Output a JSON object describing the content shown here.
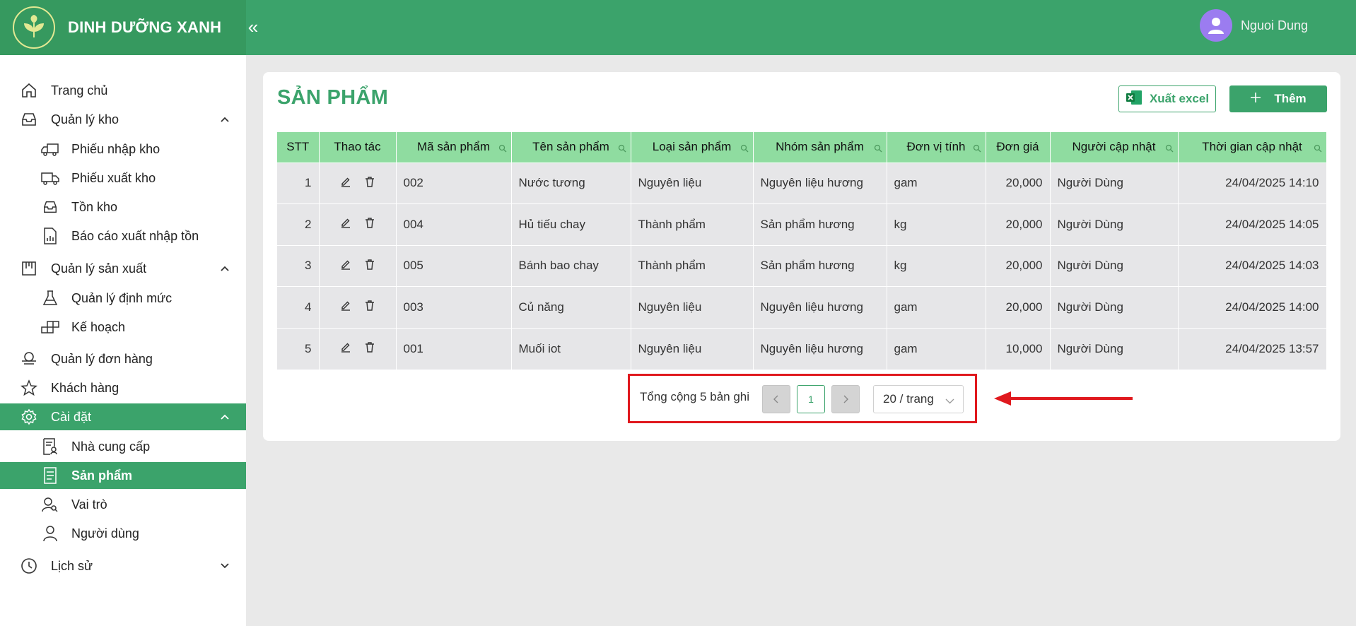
{
  "header": {
    "brand": "DINH DƯỠNG XANH",
    "collapse": "«",
    "user_name": "Nguoi Dung"
  },
  "sidebar": {
    "home": "Trang chủ",
    "warehouse": "Quản lý kho",
    "import_slip": "Phiếu nhập kho",
    "export_slip": "Phiếu xuất kho",
    "stock": "Tồn kho",
    "report": "Báo cáo xuất nhập tồn",
    "production": "Quản lý sản xuất",
    "norm": "Quản lý định mức",
    "plan": "Kế hoạch",
    "orders": "Quản lý đơn hàng",
    "customers": "Khách hàng",
    "settings": "Cài đặt",
    "suppliers": "Nhà cung cấp",
    "products": "Sản phẩm",
    "roles": "Vai trò",
    "users": "Người dùng",
    "history": "Lịch sử"
  },
  "main": {
    "title": "SẢN PHẨM",
    "export_label": "Xuất excel",
    "add_label": "Thêm"
  },
  "table": {
    "headers": [
      "STT",
      "Thao tác",
      "Mã sản phẩm",
      "Tên sản phẩm",
      "Loại sản phẩm",
      "Nhóm sản phẩm",
      "Đơn vị tính",
      "Đơn giá",
      "Người cập nhật",
      "Thời gian cập nhật"
    ],
    "rows": [
      [
        "1",
        "002",
        "Nước tương",
        "Nguyên liệu",
        "Nguyên liệu hương",
        "gam",
        "20,000",
        "Người Dùng",
        "24/04/2025 14:10"
      ],
      [
        "2",
        "004",
        "Hủ tiếu chay",
        "Thành phẩm",
        "Sản phẩm hương",
        "kg",
        "20,000",
        "Người Dùng",
        "24/04/2025 14:05"
      ],
      [
        "3",
        "005",
        "Bánh bao chay",
        "Thành phẩm",
        "Sản phẩm hương",
        "kg",
        "20,000",
        "Người Dùng",
        "24/04/2025 14:03"
      ],
      [
        "4",
        "003",
        "Củ năng",
        "Nguyên liệu",
        "Nguyên liệu hương",
        "gam",
        "20,000",
        "Người Dùng",
        "24/04/2025 14:00"
      ],
      [
        "5",
        "001",
        "Muối iot",
        "Nguyên liệu",
        "Nguyên liệu hương",
        "gam",
        "10,000",
        "Người Dùng",
        "24/04/2025 13:57"
      ]
    ]
  },
  "pagination": {
    "total_text": "Tổng cộng 5 bản ghi",
    "current_page": "1",
    "page_size": "20 / trang"
  },
  "colors": {
    "primary": "#3ba36b",
    "header_row": "#8fdca0",
    "highlight": "#e0191e"
  }
}
